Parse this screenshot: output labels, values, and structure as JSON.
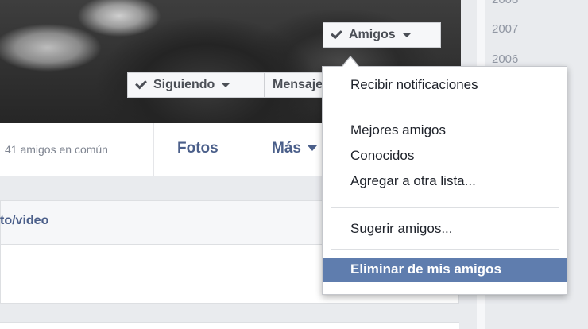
{
  "cover": {
    "friends_button": "Amigos",
    "following_button": "Siguiendo",
    "message_button": "Mensaje"
  },
  "timeline": {
    "years": [
      "2008",
      "2007",
      "2006"
    ]
  },
  "nav": {
    "mutual_friends": "41 amigos en común",
    "tabs": [
      "Fotos",
      "Más"
    ]
  },
  "composer": {
    "label": "to/video"
  },
  "friends_menu": {
    "items": [
      "Recibir notificaciones",
      "Mejores amigos",
      "Conocidos",
      "Agregar a otra lista...",
      "Sugerir amigos...",
      "Eliminar de mis amigos"
    ],
    "highlight_color": "#5f7dae"
  }
}
